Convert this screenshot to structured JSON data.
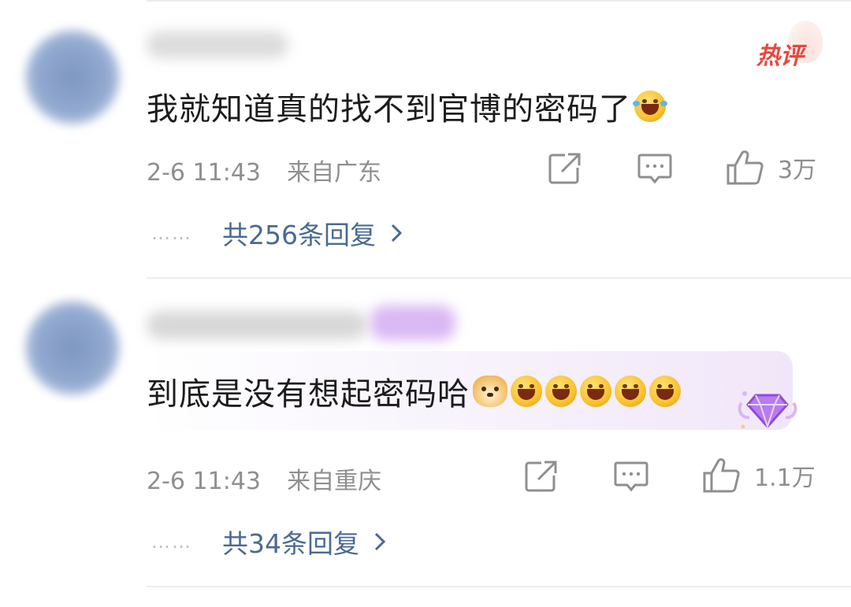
{
  "comments": [
    {
      "text": "我就知道真的找不到官博的密码了",
      "badge": "热评",
      "time": "2-6 11:43",
      "location": "来自广东",
      "likes": "3万",
      "replies_link": "共256条回复",
      "emoji_names": [
        "laughing-tears-emoji"
      ]
    },
    {
      "text": "到底是没有想起密码哈",
      "time": "2-6 11:43",
      "location": "来自重庆",
      "likes": "1.1万",
      "replies_link": "共34条回复",
      "emoji_names": [
        "doge-emoji",
        "grin-emoji",
        "grin-emoji",
        "grin-emoji",
        "grin-emoji",
        "grin-emoji"
      ]
    }
  ],
  "reply_dots": "……",
  "colors": {
    "link": "#4a6a92",
    "meta": "#8f8f8f",
    "hot_badge": "#e8473d",
    "text": "#1c1c1c",
    "bubble": "#f1e6f9"
  }
}
